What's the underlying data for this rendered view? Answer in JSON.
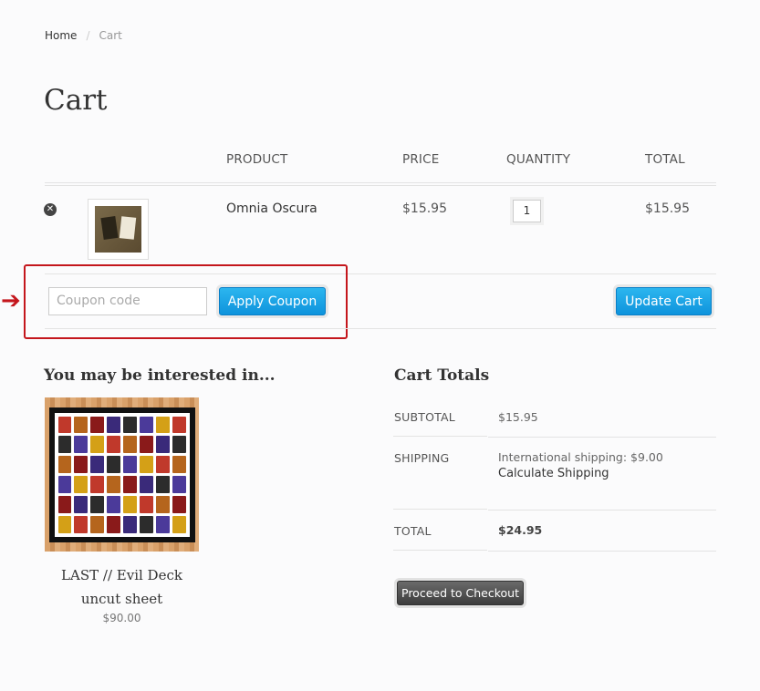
{
  "breadcrumb": {
    "home": "Home",
    "separator": "/",
    "current": "Cart"
  },
  "page_title": "Cart",
  "table": {
    "headers": {
      "product": "PRODUCT",
      "price": "PRICE",
      "quantity": "QUANTITY",
      "total": "TOTAL"
    },
    "rows": [
      {
        "remove_icon": "close-icon",
        "product": "Omnia Oscura",
        "price": "$15.95",
        "quantity": "1",
        "total": "$15.95"
      }
    ]
  },
  "coupon": {
    "placeholder": "Coupon code",
    "apply_label": "Apply Coupon",
    "update_label": "Update Cart",
    "arrow": "➔"
  },
  "related": {
    "title": "You may be interested in...",
    "item": {
      "name": "LAST // Evil Deck uncut sheet",
      "price": "$90.00"
    }
  },
  "totals": {
    "title": "Cart Totals",
    "subtotal_label": "SUBTOTAL",
    "subtotal_value": "$15.95",
    "shipping_label": "SHIPPING",
    "shipping_value": "International shipping: $9.00",
    "calc_shipping": "Calculate Shipping",
    "total_label": "TOTAL",
    "total_value": "$24.95",
    "checkout_label": "Proceed to Checkout"
  },
  "colors": {
    "accent": "#1aa3e8",
    "highlight": "#c4161c",
    "dark_button": "#4a4a4a"
  }
}
